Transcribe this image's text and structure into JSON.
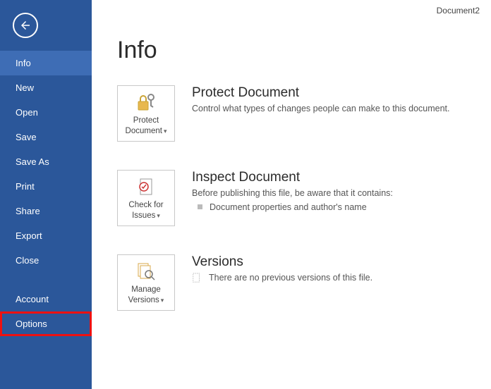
{
  "doc_title": "Document2",
  "page_title": "Info",
  "sidebar": {
    "items": [
      {
        "label": "Info",
        "selected": true
      },
      {
        "label": "New"
      },
      {
        "label": "Open"
      },
      {
        "label": "Save"
      },
      {
        "label": "Save As"
      },
      {
        "label": "Print"
      },
      {
        "label": "Share"
      },
      {
        "label": "Export"
      },
      {
        "label": "Close"
      }
    ],
    "bottom_items": [
      {
        "label": "Account"
      },
      {
        "label": "Options",
        "highlight": true
      }
    ]
  },
  "sections": {
    "protect": {
      "tile_label_line1": "Protect",
      "tile_label_line2": "Document",
      "heading": "Protect Document",
      "desc": "Control what types of changes people can make to this document."
    },
    "inspect": {
      "tile_label_line1": "Check for",
      "tile_label_line2": "Issues",
      "heading": "Inspect Document",
      "desc": "Before publishing this file, be aware that it contains:",
      "bullet": "Document properties and author's name"
    },
    "versions": {
      "tile_label_line1": "Manage",
      "tile_label_line2": "Versions",
      "heading": "Versions",
      "desc": "There are no previous versions of this file."
    }
  }
}
